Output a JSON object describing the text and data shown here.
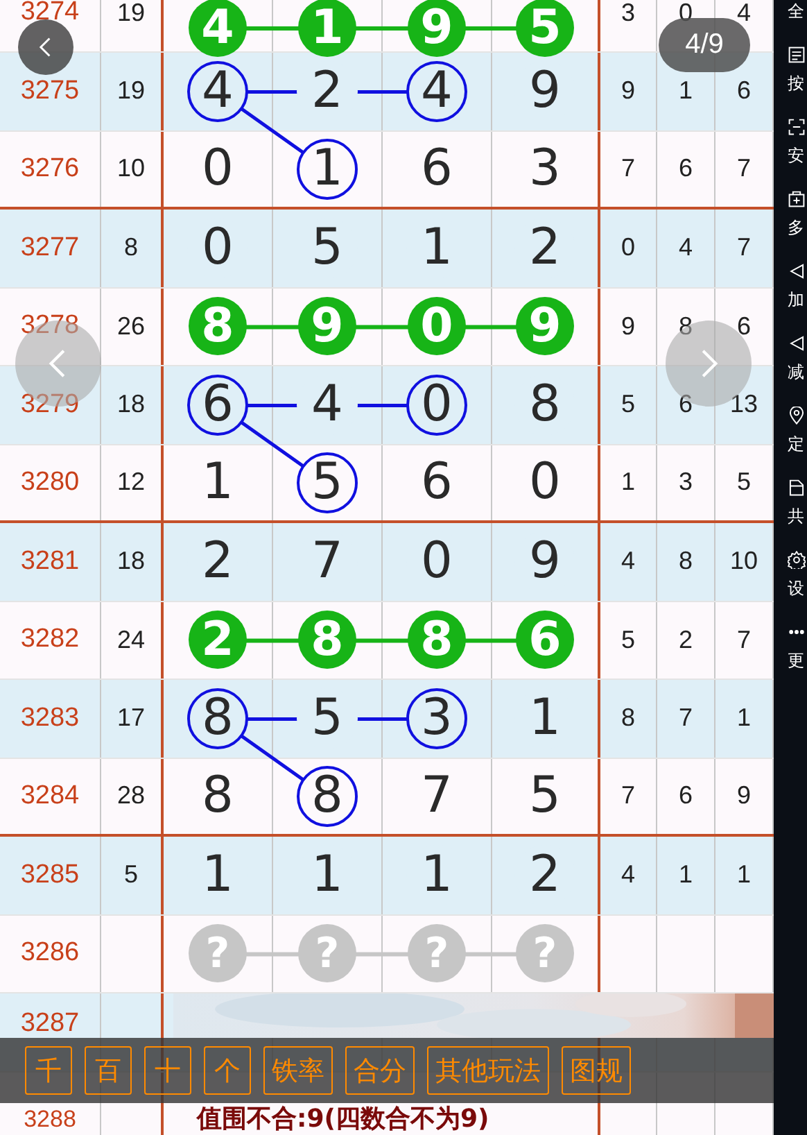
{
  "groups": [
    {
      "rows": [
        {
          "period": "3274",
          "sum": "19",
          "kind": "linked",
          "digits": [
            {
              "value": "4"
            },
            {
              "value": "1"
            },
            {
              "value": "9"
            },
            {
              "value": "5"
            }
          ],
          "stats": [
            "3",
            "0",
            "4"
          ]
        },
        {
          "period": "3275",
          "sum": "19",
          "kind": "plain",
          "digits": [
            {
              "value": "4",
              "circled": true
            },
            {
              "value": "2",
              "circled": false
            },
            {
              "value": "4",
              "circled": true
            },
            {
              "value": "9",
              "circled": false
            }
          ],
          "stats": [
            "9",
            "1",
            "6"
          ]
        },
        {
          "period": "3276",
          "sum": "10",
          "kind": "plain",
          "digits": [
            {
              "value": "0",
              "circled": false
            },
            {
              "value": "1",
              "circled": true
            },
            {
              "value": "6",
              "circled": false
            },
            {
              "value": "3",
              "circled": false
            }
          ],
          "stats": [
            "7",
            "6",
            "7"
          ]
        }
      ]
    },
    {
      "rows": [
        {
          "period": "3277",
          "sum": "8",
          "kind": "plain",
          "digits": [
            {
              "value": "0",
              "circled": false
            },
            {
              "value": "5",
              "circled": false
            },
            {
              "value": "1",
              "circled": false
            },
            {
              "value": "2",
              "circled": false
            }
          ],
          "stats": [
            "0",
            "4",
            "7"
          ]
        },
        {
          "period": "3278",
          "sum": "26",
          "kind": "linked",
          "digits": [
            {
              "value": "8"
            },
            {
              "value": "9"
            },
            {
              "value": "0"
            },
            {
              "value": "9"
            }
          ],
          "stats": [
            "9",
            "8",
            "6"
          ]
        },
        {
          "period": "3279",
          "sum": "18",
          "kind": "plain",
          "digits": [
            {
              "value": "6",
              "circled": true
            },
            {
              "value": "4",
              "circled": false
            },
            {
              "value": "0",
              "circled": true
            },
            {
              "value": "8",
              "circled": false
            }
          ],
          "stats": [
            "5",
            "6",
            "13"
          ]
        },
        {
          "period": "3280",
          "sum": "12",
          "kind": "plain",
          "digits": [
            {
              "value": "1",
              "circled": false
            },
            {
              "value": "5",
              "circled": true
            },
            {
              "value": "6",
              "circled": false
            },
            {
              "value": "0",
              "circled": false
            }
          ],
          "stats": [
            "1",
            "3",
            "5"
          ]
        }
      ]
    },
    {
      "rows": [
        {
          "period": "3281",
          "sum": "18",
          "kind": "plain",
          "digits": [
            {
              "value": "2",
              "circled": false
            },
            {
              "value": "7",
              "circled": false
            },
            {
              "value": "0",
              "circled": false
            },
            {
              "value": "9",
              "circled": false
            }
          ],
          "stats": [
            "4",
            "8",
            "10"
          ]
        },
        {
          "period": "3282",
          "sum": "24",
          "kind": "linked",
          "digits": [
            {
              "value": "2"
            },
            {
              "value": "8"
            },
            {
              "value": "8"
            },
            {
              "value": "6"
            }
          ],
          "stats": [
            "5",
            "2",
            "7"
          ]
        },
        {
          "period": "3283",
          "sum": "17",
          "kind": "plain",
          "digits": [
            {
              "value": "8",
              "circled": true
            },
            {
              "value": "5",
              "circled": false
            },
            {
              "value": "3",
              "circled": true
            },
            {
              "value": "1",
              "circled": false
            }
          ],
          "stats": [
            "8",
            "7",
            "1"
          ]
        },
        {
          "period": "3284",
          "sum": "28",
          "kind": "plain",
          "digits": [
            {
              "value": "8",
              "circled": false
            },
            {
              "value": "8",
              "circled": true
            },
            {
              "value": "7",
              "circled": false
            },
            {
              "value": "5",
              "circled": false
            }
          ],
          "stats": [
            "7",
            "6",
            "9"
          ]
        }
      ]
    },
    {
      "rows": [
        {
          "period": "3285",
          "sum": "5",
          "kind": "plain",
          "digits": [
            {
              "value": "1",
              "circled": false
            },
            {
              "value": "1",
              "circled": false
            },
            {
              "value": "1",
              "circled": false
            },
            {
              "value": "2",
              "circled": false
            }
          ],
          "stats": [
            "4",
            "1",
            "1"
          ]
        },
        {
          "period": "3286",
          "kind": "pending",
          "digits": [
            {
              "value": "?"
            },
            {
              "value": "?"
            },
            {
              "value": "?"
            },
            {
              "value": "?"
            }
          ]
        },
        {
          "period": "3287",
          "kind": "blank"
        },
        {
          "period": "3288",
          "kind": "note",
          "note": "值围不合:9(四数合不为9)"
        }
      ]
    }
  ],
  "viewer": {
    "counter": "4/9"
  },
  "toolbar": [
    "千",
    "百",
    "十",
    "个",
    "铁率",
    "合分",
    "其他玩法",
    "图规"
  ],
  "sidebar": [
    "全",
    "按",
    "安",
    "多",
    "加",
    "减",
    "定",
    "共",
    "设",
    "更"
  ]
}
